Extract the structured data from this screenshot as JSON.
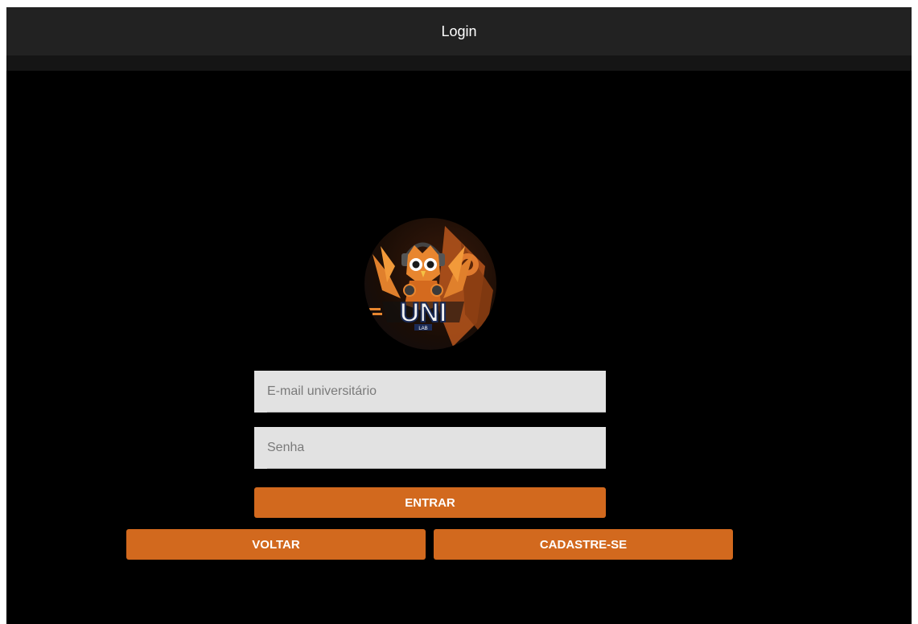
{
  "header": {
    "title": "Login"
  },
  "logo": {
    "text": "UNI",
    "subtext": "LAB",
    "description": "owl-mascot-logo"
  },
  "form": {
    "email_placeholder": "E-mail universitário",
    "email_value": "",
    "password_placeholder": "Senha",
    "password_value": "",
    "submit_label": "ENTRAR",
    "back_label": "VOLTAR",
    "register_label": "CADASTRE-SE"
  },
  "colors": {
    "background": "#000000",
    "header": "#222222",
    "accent": "#d2691e",
    "field": "#e2e2e2"
  }
}
